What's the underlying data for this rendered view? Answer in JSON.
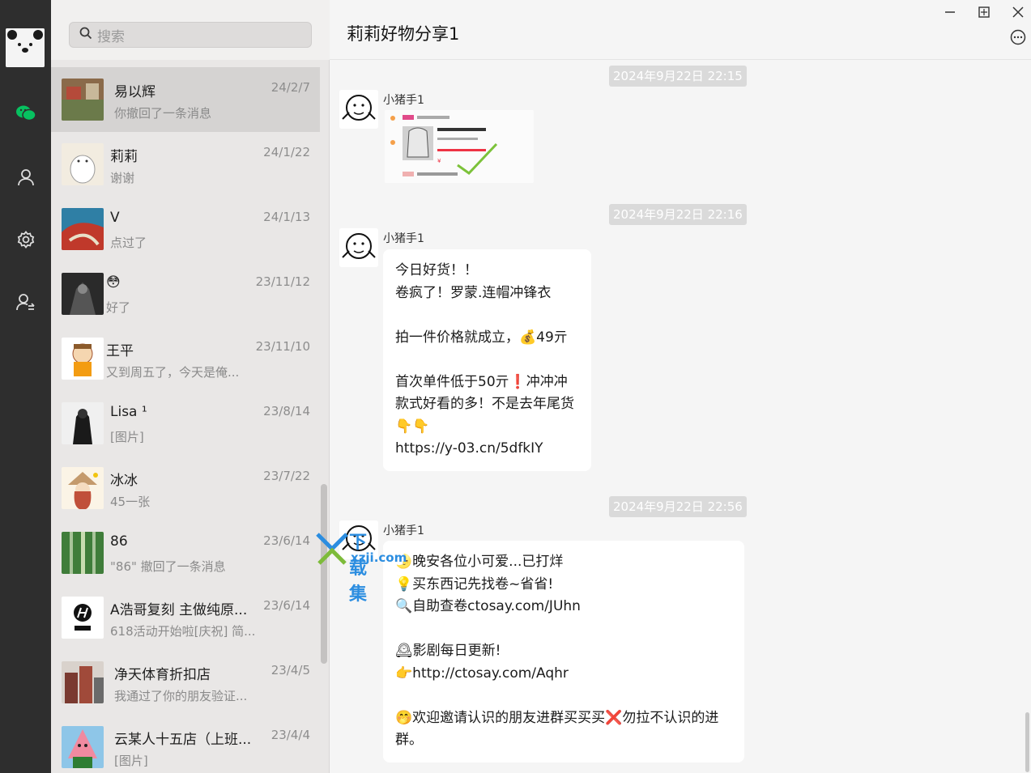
{
  "search": {
    "placeholder": "搜索"
  },
  "conversations": [
    {
      "name": "易以辉",
      "preview": "你撤回了一条消息",
      "date": "24/2/7"
    },
    {
      "name": "莉莉",
      "preview": "谢谢",
      "date": "24/1/22"
    },
    {
      "name": "V",
      "preview": "点过了",
      "date": "24/1/13"
    },
    {
      "name": "😳",
      "preview": "好了",
      "date": "23/11/12"
    },
    {
      "name": "王平",
      "preview": "又到周五了，今天是俺...",
      "date": "23/11/10"
    },
    {
      "name": "Lisa ¹",
      "preview": "[图片]",
      "date": "23/8/14"
    },
    {
      "name": "冰冰",
      "preview": "45一张",
      "date": "23/7/22"
    },
    {
      "name": "86",
      "preview": "\"86\" 撤回了一条消息",
      "date": "23/6/14"
    },
    {
      "name": "A浩哥复刻 主做纯原...",
      "preview": "618活动开始啦[庆祝] 简...",
      "date": "23/6/14"
    },
    {
      "name": "净天体育折扣店",
      "preview": "我通过了你的朋友验证...",
      "date": "23/4/5"
    },
    {
      "name": "云某人十五店（上班...",
      "preview": "[图片]",
      "date": "23/4/4"
    }
  ],
  "chat": {
    "title": "莉莉好物分享1",
    "messages": [
      {
        "time": "2024年9月22日 22:15",
        "sender": "小猪手1"
      },
      {
        "time": "2024年9月22日 22:16",
        "sender": "小猪手1",
        "lines": [
          "今日好货！！",
          "卷疯了！罗蒙.连帽冲锋衣",
          "",
          "拍一件价格就成立，💰49亓",
          "",
          "首次单件低于50亓❗冲冲冲",
          "款式好看的多！不是去年尾货",
          "👇👇",
          "https://y-03.cn/5dfkIY"
        ]
      },
      {
        "time": "2024年9月22日 22:56",
        "sender": "小猪手1",
        "lines": [
          "🌛晚安各位小可爱...已打烊",
          "💡买东西记先找卷~省省!",
          "🔍自助查卷ctosay.com/JUhn",
          "",
          "🕰影剧每日更新!",
          "👉http://ctosay.com/Aqhr",
          "",
          "🤭欢迎邀请认识的朋友进群买买买❌勿拉不认识的进",
          "群。"
        ]
      }
    ]
  },
  "watermark": {
    "text": "下载集",
    "url": "xzji.com"
  }
}
